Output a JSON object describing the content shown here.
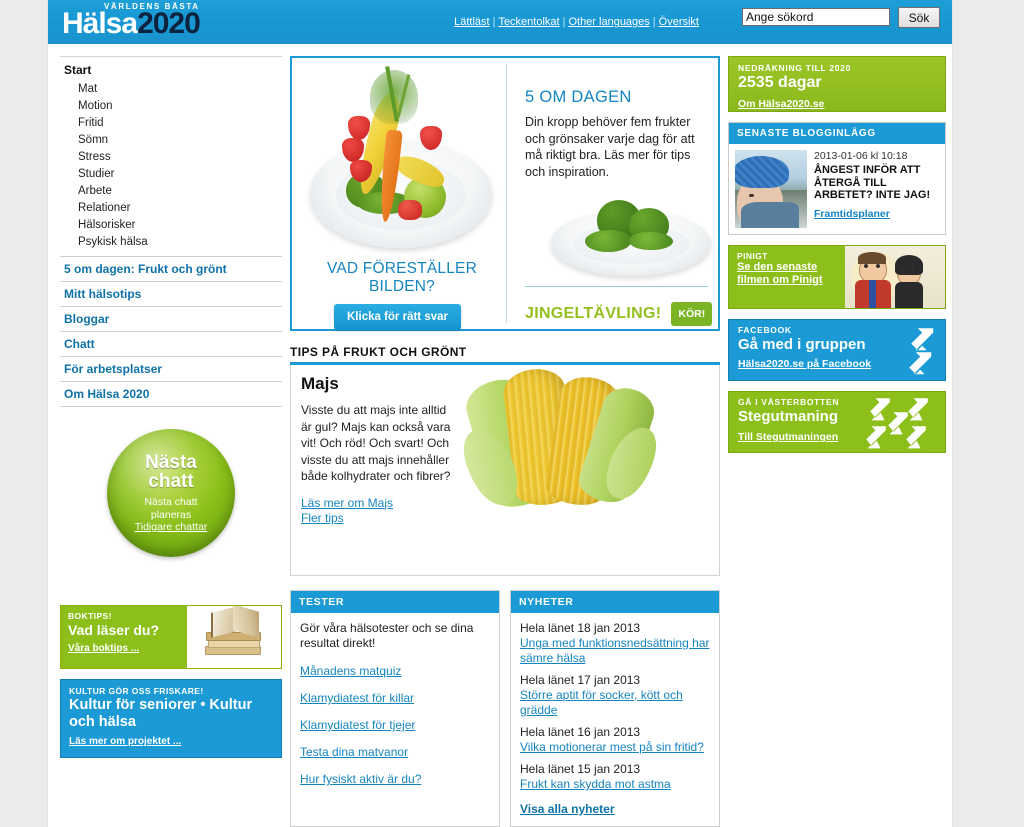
{
  "header": {
    "logo_kicker": "VÄRLDENS BÄSTA",
    "logo_white": "Hälsa",
    "logo_dark": "2020",
    "links": [
      {
        "label": "Lättläst"
      },
      {
        "label": "Teckentolkat"
      },
      {
        "label": "Other languages"
      },
      {
        "label": "Översikt"
      }
    ],
    "search_value": "Ange sökord",
    "search_placeholder": "Ange sökord",
    "search_button": "Sök"
  },
  "sidebar": {
    "start_label": "Start",
    "sub_items": [
      {
        "label": "Mat"
      },
      {
        "label": "Motion"
      },
      {
        "label": "Fritid"
      },
      {
        "label": "Sömn"
      },
      {
        "label": "Stress"
      },
      {
        "label": "Studier"
      },
      {
        "label": "Arbete"
      },
      {
        "label": "Relationer"
      },
      {
        "label": "Hälsorisker"
      },
      {
        "label": "Psykisk hälsa"
      }
    ],
    "sections": [
      {
        "label": "5 om dagen: Frukt och grönt"
      },
      {
        "label": "Mitt hälsotips"
      },
      {
        "label": "Bloggar"
      },
      {
        "label": "Chatt"
      },
      {
        "label": "För arbetsplatser"
      },
      {
        "label": "Om Hälsa 2020"
      }
    ],
    "chat": {
      "title_line1": "Nästa",
      "title_line2": "chatt",
      "sub_line1": "Nästa chatt",
      "sub_line2": "planeras",
      "link": "Tidigare chattar"
    },
    "boktips": {
      "kicker": "BOKTIPS!",
      "heading": "Vad läser du?",
      "link": "Våra boktips ..."
    },
    "kultur": {
      "kicker": "KULTUR GÖR OSS FRISKARE!",
      "heading": "Kultur för seniorer • Kultur och hälsa",
      "link": "Läs mer om projektet ..."
    }
  },
  "hero": {
    "caption_line1": "VAD FÖRESTÄLLER",
    "caption_line2": "BILDEN?",
    "button": "Klicka för rätt svar",
    "title": "5 OM DAGEN",
    "body": "Din kropp behöver fem frukter och grönsaker varje dag för att må riktigt bra. Läs mer för tips och inspiration.",
    "jingel_text": "JINGELTÄVLING!",
    "jingel_button": "KÖR!"
  },
  "tips": {
    "section_head": "TIPS PÅ FRUKT OCH GRÖNT",
    "title": "Majs",
    "body": "Visste du att majs inte alltid är gul? Majs kan också vara vit! Och röd! Och svart! Och visste du att majs innehåller både kolhydrater och fibrer?",
    "links": [
      {
        "label": "Läs mer om Majs"
      },
      {
        "label": "Fler tips"
      }
    ]
  },
  "tester": {
    "head": "TESTER",
    "intro": "Gör våra hälsotester och se dina resultat direkt!",
    "links": [
      {
        "label": "Månadens matquiz"
      },
      {
        "label": "Klamydiatest för killar"
      },
      {
        "label": "Klamydiatest för tjejer"
      },
      {
        "label": "Testa dina matvanor"
      },
      {
        "label": "Hur fysiskt aktiv är du?"
      }
    ]
  },
  "nyheter": {
    "head": "NYHETER",
    "items": [
      {
        "date": "Hela länet 18 jan 2013",
        "title": "Unga med funktionsnedsättning har sämre hälsa"
      },
      {
        "date": "Hela länet 17 jan 2013",
        "title": "Större aptit för socker, kött och grädde"
      },
      {
        "date": "Hela länet 16 jan 2013",
        "title": "Vilka motionerar mest på sin fritid?"
      },
      {
        "date": "Hela länet 15 jan 2013",
        "title": "Frukt kan skydda mot astma"
      }
    ],
    "all_link": "Visa alla nyheter"
  },
  "right": {
    "countdown": {
      "kicker": "NEDRÄKNING TILL 2020",
      "value": "2535 dagar",
      "link": "Om Hälsa2020.se"
    },
    "blog": {
      "head": "SENASTE BLOGGINLÄGG",
      "date": "2013-01-06 kl 10:18",
      "title": "ÅNGEST INFÖR ATT ÅTERGÅ TILL ARBETET? INTE JAG!",
      "link": "Framtidsplaner"
    },
    "pinigt": {
      "kicker": "PINIGT",
      "link_line1": "Se den senaste",
      "link_line2": "filmen om Pinigt"
    },
    "facebook": {
      "kicker": "FACEBOOK",
      "heading": "Gå med i gruppen",
      "link": "Hälsa2020.se på Facebook"
    },
    "steg": {
      "kicker": "GÅ I VÄSTERBOTTEN",
      "heading": "Stegutmaning",
      "link": "Till Stegutmaningen"
    }
  },
  "colors": {
    "brand_blue": "#1b9ad6",
    "brand_green": "#8dbf1a",
    "link_blue": "#1585c0",
    "nav_blue": "#0e72a8",
    "logo_dark": "#0c2340"
  }
}
